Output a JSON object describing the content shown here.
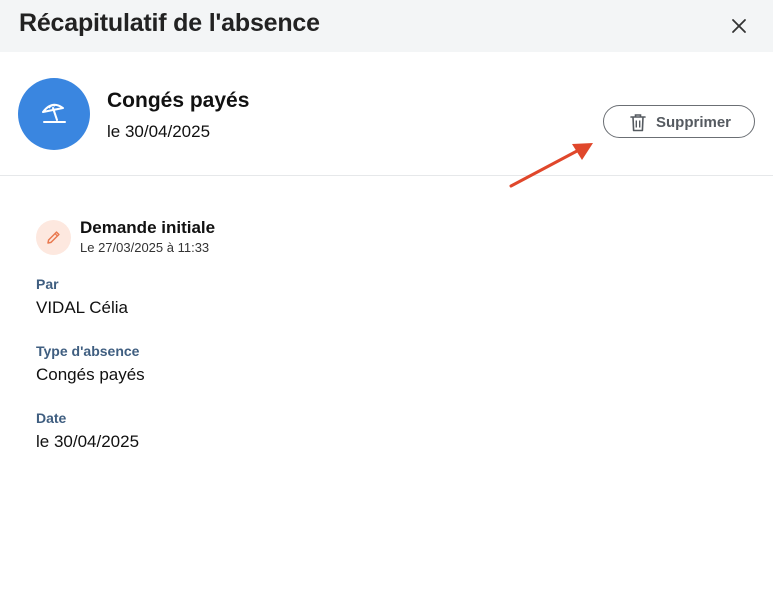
{
  "header": {
    "title": "Récapitulatif de l'absence",
    "close_icon": "close-icon"
  },
  "summary": {
    "icon": "beach-umbrella-icon",
    "icon_color": "#3a86e0",
    "title": "Congés payés",
    "date": "le 30/04/2025",
    "delete_label": "Supprimer",
    "delete_icon": "trash-icon"
  },
  "annotation": {
    "arrow_color": "#e0472b"
  },
  "history": {
    "icon": "pencil-icon",
    "title": "Demande initiale",
    "timestamp": "Le 27/03/2025 à 11:33"
  },
  "details": [
    {
      "label": "Par",
      "value": "VIDAL Célia"
    },
    {
      "label": "Type d'absence",
      "value": "Congés payés"
    },
    {
      "label": "Date",
      "value": "le 30/04/2025"
    }
  ]
}
